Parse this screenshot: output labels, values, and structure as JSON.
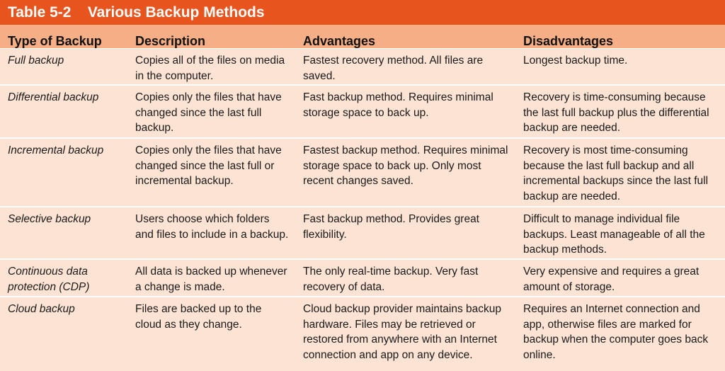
{
  "table": {
    "title": "Table 5-2    Various Backup Methods",
    "headers": [
      "Type of Backup",
      "Description",
      "Advantages",
      "Disadvantages"
    ],
    "rows": [
      {
        "type": "Full backup",
        "description": "Copies all of the files on media in the computer.",
        "advantages": "Fastest recovery method. All files are saved.",
        "disadvantages": "Longest backup time."
      },
      {
        "type": "Differential backup",
        "description": "Copies only the files that have changed since the last full backup.",
        "advantages": "Fast backup method. Requires minimal storage space to back up.",
        "disadvantages": "Recovery is time-consuming because the last full backup plus the differential backup are needed."
      },
      {
        "type": "Incremental backup",
        "description": "Copies only the files that have changed since the last full or incremental backup.",
        "advantages": "Fastest backup method. Requires minimal storage space to back up. Only most recent changes saved.",
        "disadvantages": "Recovery is most time-consuming because the last full backup and all incremental backups since the last full backup are needed."
      },
      {
        "type": "Selective backup",
        "description": "Users choose which folders and files to include in a backup.",
        "advantages": "Fast backup method. Provides great flexibility.",
        "disadvantages": "Difficult to manage individual file backups. Least manageable of all the backup methods."
      },
      {
        "type": "Continuous data protection (CDP)",
        "description": "All data is backed up whenever a change is made.",
        "advantages": "The only real-time backup. Very fast recovery of data.",
        "disadvantages": "Very expensive and requires a great amount of storage."
      },
      {
        "type": "Cloud backup",
        "description": "Files are backed up to the cloud as they change.",
        "advantages": "Cloud backup provider maintains backup hardware. Files may be retrieved or restored from anywhere with an Internet connection and app on any device.",
        "disadvantages": "Requires an Internet connection and app, otherwise files are marked for backup when the computer goes back online."
      }
    ]
  }
}
